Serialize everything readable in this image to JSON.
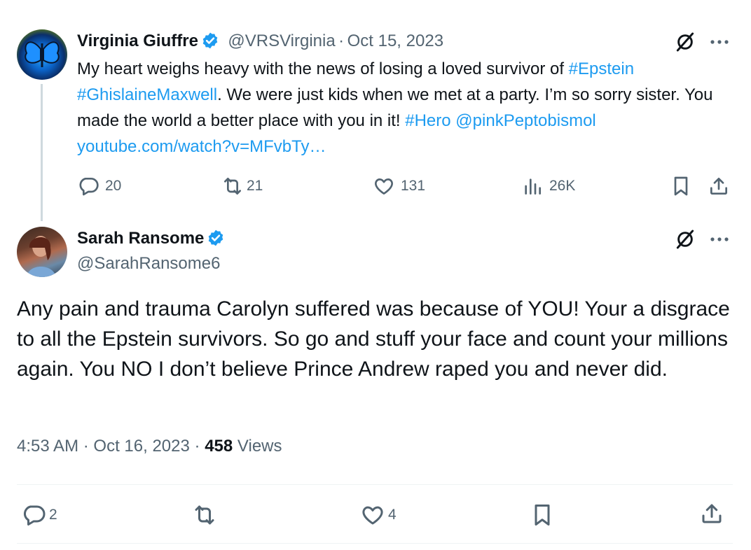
{
  "tweet1": {
    "name": "Virginia Giuffre",
    "handle": "@VRSVirginia",
    "sep": "·",
    "date": "Oct 15, 2023",
    "segments": [
      {
        "text": "My heart weighs heavy with the news of losing a loved survivor of ",
        "link": false
      },
      {
        "text": "#Epstein",
        "link": true
      },
      {
        "text": " ",
        "link": false
      },
      {
        "text": "#GhislaineMaxwell",
        "link": true
      },
      {
        "text": ". We were just kids when we met at a party. I’m so sorry sister. You made the world a better place with you in it! ",
        "link": false
      },
      {
        "text": "#Hero",
        "link": true
      },
      {
        "text": " ",
        "link": false
      },
      {
        "text": "@pinkPeptobismol",
        "link": true
      },
      {
        "text": "  ",
        "link": false
      },
      {
        "text": "youtube.com/watch?v=MFvbTy…",
        "link": true
      }
    ],
    "replies": "20",
    "reposts": "21",
    "likes": "131",
    "views": "26K"
  },
  "tweet2": {
    "name": "Sarah Ransome",
    "handle": "@SarahRansome6",
    "body": "Any pain and trauma Carolyn suffered was because of YOU! Your a disgrace to all the Epstein survivors. So go and stuff your face and count your millions again. You NO I don’t believe Prince Andrew raped you and never did.",
    "time": "4:53 AM",
    "sep1": "·",
    "date": "Oct 16, 2023",
    "sep2": "·",
    "views_count": "458",
    "views_label": "Views",
    "replies": "2",
    "likes": "4"
  },
  "colors": {
    "link": "#1d9bf0",
    "muted": "#536471",
    "text": "#0f1419",
    "verified": "#1d9bf0"
  }
}
